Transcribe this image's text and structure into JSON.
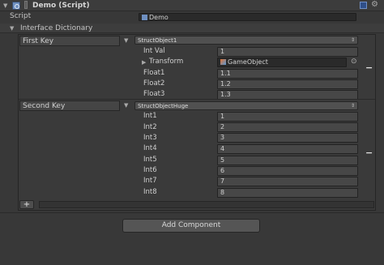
{
  "component": {
    "title": "Demo (Script)"
  },
  "script_field": {
    "label": "Script",
    "value": "Demo"
  },
  "dictionary": {
    "label": "Interface Dictionary"
  },
  "entries": [
    {
      "key": "First Key",
      "type": "StructObject1",
      "transform": {
        "label": "Transform",
        "value": "GameObject"
      },
      "fields": [
        {
          "label": "Int Val",
          "value": "1"
        },
        {
          "label": "Float1",
          "value": "1.1"
        },
        {
          "label": "Float2",
          "value": "1.2"
        },
        {
          "label": "Float3",
          "value": "1.3"
        }
      ]
    },
    {
      "key": "Second Key",
      "type": "StructObjectHuge",
      "fields": [
        {
          "label": "Int1",
          "value": "1"
        },
        {
          "label": "Int2",
          "value": "2"
        },
        {
          "label": "Int3",
          "value": "3"
        },
        {
          "label": "Int4",
          "value": "4"
        },
        {
          "label": "Int5",
          "value": "5"
        },
        {
          "label": "Int6",
          "value": "6"
        },
        {
          "label": "Int7",
          "value": "7"
        },
        {
          "label": "Int8",
          "value": "8"
        }
      ]
    }
  ],
  "controls": {
    "plus": "+",
    "minus": "−",
    "add_component": "Add Component"
  },
  "icons": {
    "fold": "fold-triangle-icon",
    "script": "script-icon",
    "gameobject": "gameobject-icon",
    "target": "object-picker-icon",
    "settings": "gear-icon",
    "help": "help-book-icon"
  }
}
